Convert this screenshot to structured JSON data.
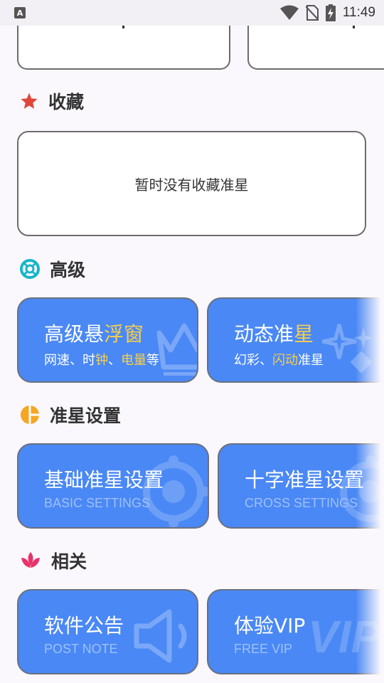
{
  "status_bar": {
    "time": "11:49"
  },
  "favorites": {
    "title": "收藏",
    "empty_text": "暂时没有收藏准星"
  },
  "advanced": {
    "title": "高级",
    "tiles": [
      {
        "title_plain": "高级悬",
        "title_hl": "浮窗",
        "sub_a": "网速、时",
        "sub_hl_a": "钟",
        "sub_b": "、",
        "sub_hl_b": "电量",
        "sub_c": "等"
      },
      {
        "title_plain": "动态准",
        "title_hl": "星",
        "sub_a": "幻彩、",
        "sub_hl_a": "闪动",
        "sub_b": "准星"
      }
    ]
  },
  "crosshair_settings": {
    "title": "准星设置",
    "tiles": [
      {
        "title": "基础准星设置",
        "subtitle": "BASIC SETTINGS"
      },
      {
        "title": "十字准星设置",
        "subtitle": "CROSS SETTINGS"
      }
    ]
  },
  "related": {
    "title": "相关",
    "tiles": [
      {
        "title": "软件公告",
        "subtitle": "POST NOTE"
      },
      {
        "title": "体验VIP",
        "subtitle": "FREE VIP",
        "watermark": "VIP"
      }
    ]
  },
  "colors": {
    "tile_blue": "#4a88f5",
    "highlight_yellow": "#f7cf4a",
    "star_red": "#e0463a",
    "advanced_teal": "#19b5c8",
    "crosshair_orange": "#f5a623",
    "related_pink": "#e8336a"
  }
}
